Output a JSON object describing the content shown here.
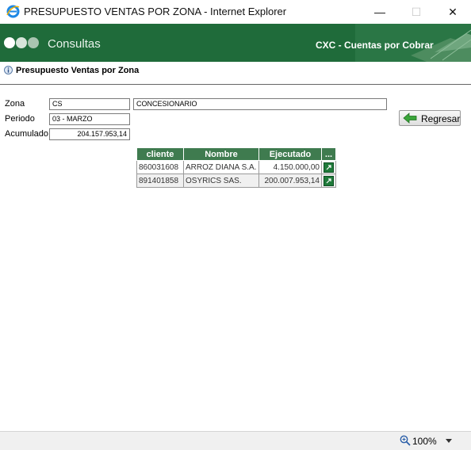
{
  "window": {
    "title": "PRESUPUESTO VENTAS POR ZONA - Internet Explorer",
    "minimize": "—",
    "maximize": "☐",
    "close": "✕"
  },
  "header": {
    "title": "Consultas",
    "right_title": "CXC - Cuentas por Cobrar"
  },
  "section": {
    "title": "Presupuesto Ventas por Zona",
    "icon": "info-icon"
  },
  "form": {
    "zona_label": "Zona",
    "zona_code": "CS",
    "zona_name": "CONCESIONARIO",
    "periodo_label": "Periodo",
    "periodo_value": "03 - MARZO",
    "acumulado_label": "Acumulado",
    "acumulado_value": "204.157.953,14"
  },
  "buttons": {
    "back_label": "Regresar",
    "back_icon": "arrow-left-icon"
  },
  "table": {
    "headers": [
      "cliente",
      "Nombre",
      "Ejecutado",
      "..."
    ],
    "rows": [
      {
        "cliente": "860031608",
        "nombre": "ARROZ DIANA S.A.",
        "ejecutado": "4.150.000,00"
      },
      {
        "cliente": "891401858",
        "nombre": "OSYRICS SAS.",
        "ejecutado": "200.007.953,14"
      }
    ]
  },
  "statusbar": {
    "zoom": "100%"
  },
  "colors": {
    "header_green": "#1f6b3a",
    "table_header": "#3f7b4f",
    "button_arrow": "#3aa53a"
  }
}
